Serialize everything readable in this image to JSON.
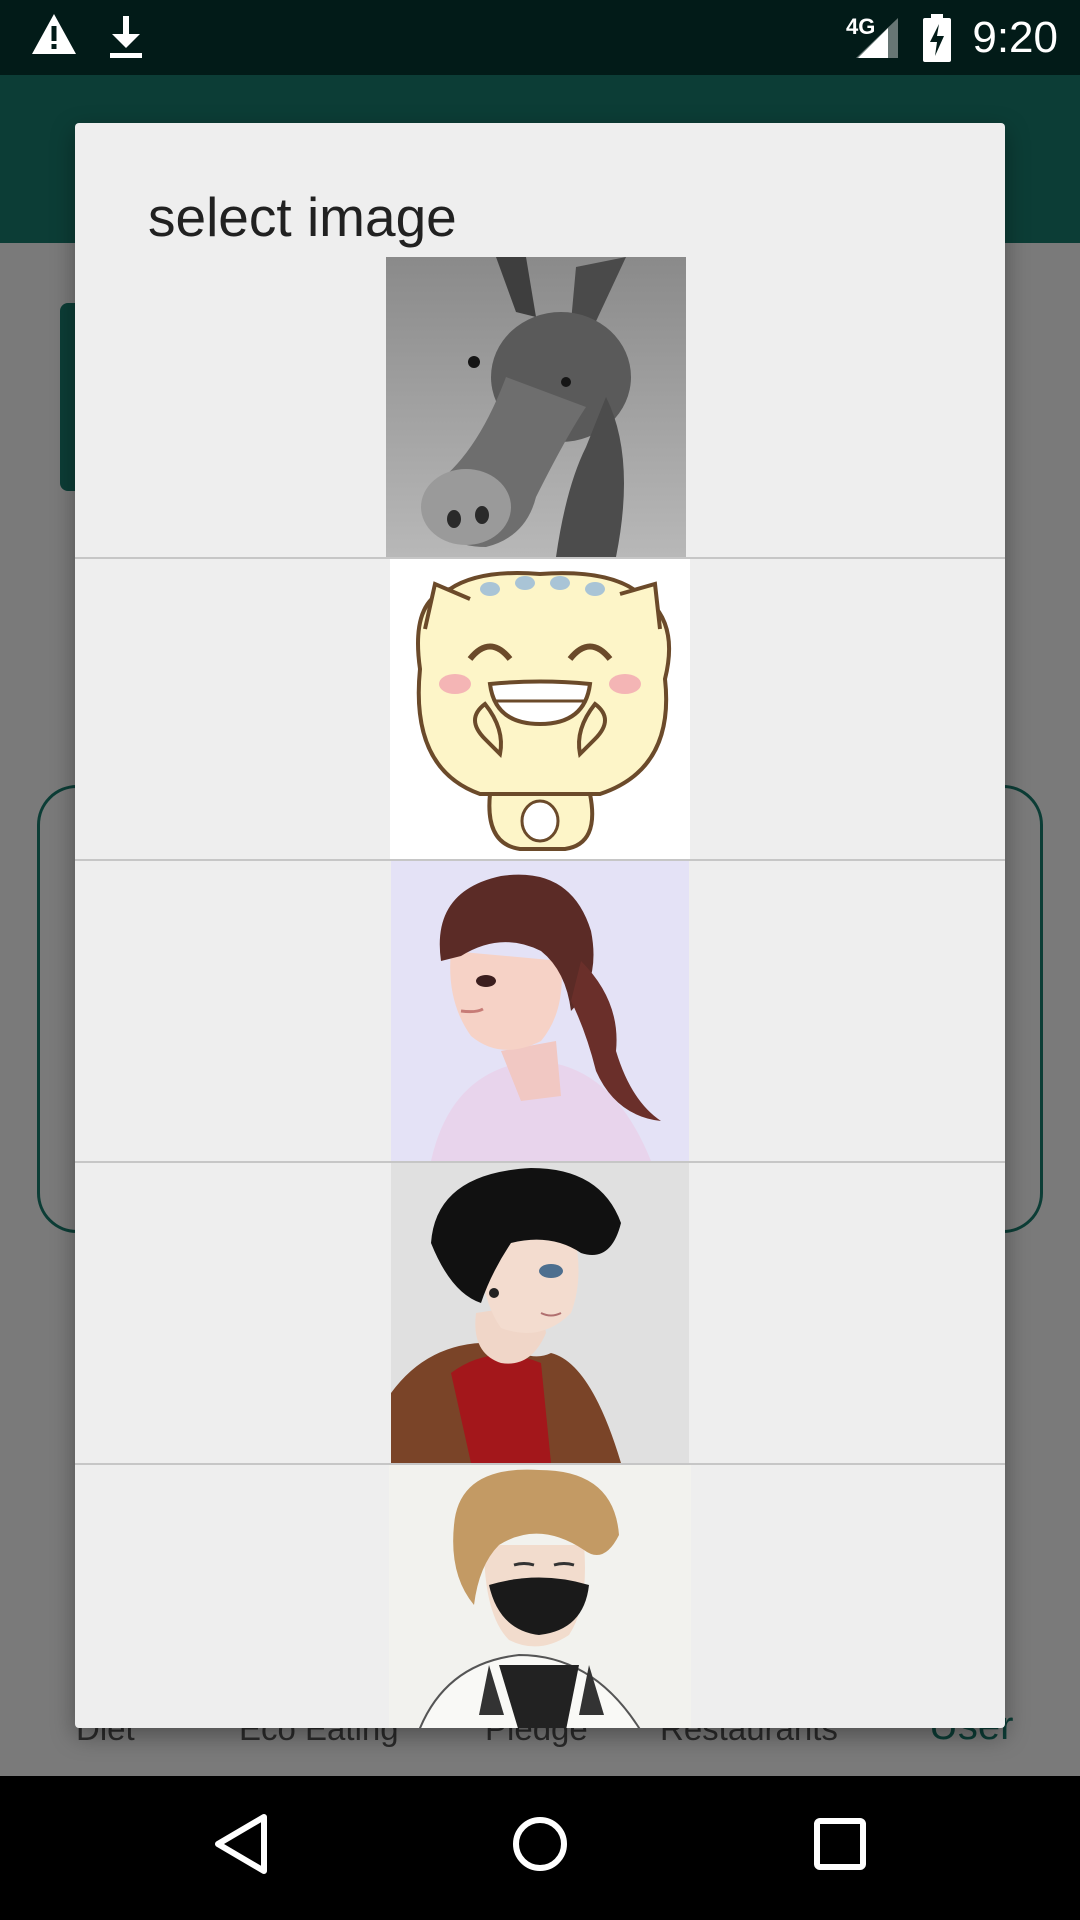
{
  "status_bar": {
    "time": "9:20",
    "network": "4G",
    "icons": [
      "warning-icon",
      "download-icon",
      "signal-icon",
      "battery-charging-icon"
    ]
  },
  "background_app": {
    "bottom_nav": [
      {
        "label": "Diet"
      },
      {
        "label": "Eco Eating"
      },
      {
        "label": "Pledge"
      },
      {
        "label": "Restaurants"
      },
      {
        "label": "User",
        "active": true
      }
    ]
  },
  "dialog": {
    "title": "select image",
    "images": [
      "donkey-image",
      "smiling-cat-sticker",
      "anime-girl-ponytail",
      "anime-boy-dark-hair",
      "anime-boy-mask"
    ]
  },
  "navigation_bar": {
    "icons": [
      "back-icon",
      "home-icon",
      "recents-icon"
    ]
  },
  "colors": {
    "status_bar": "#021b18",
    "app_bar": "#0c3d36",
    "dialog_bg": "#eeeeee",
    "scrim": "#7a7a7a"
  }
}
